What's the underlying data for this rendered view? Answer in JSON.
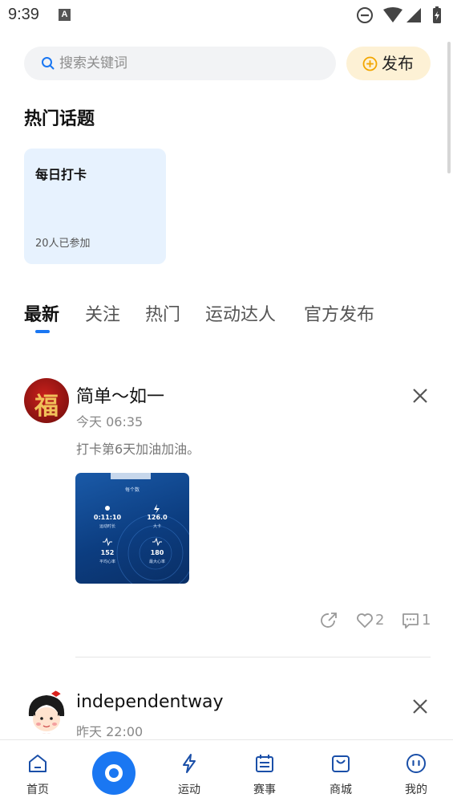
{
  "status_bar": {
    "time": "9:39",
    "notification_letter": "A"
  },
  "search": {
    "placeholder": "搜索关键词"
  },
  "publish_button": {
    "label": "发布"
  },
  "hot_topics": {
    "title": "热门话题",
    "items": [
      {
        "title": "每日打卡",
        "participants": "20人已参加"
      }
    ]
  },
  "tabs": [
    {
      "label": "最新",
      "active": true
    },
    {
      "label": "关注",
      "active": false
    },
    {
      "label": "热门",
      "active": false
    },
    {
      "label": "运动达人",
      "active": false
    },
    {
      "label": "官方发布",
      "active": false
    }
  ],
  "posts": [
    {
      "username": "简单～如一",
      "time": "今天 06:35",
      "content": "打卡第6天加油加油。",
      "avatar_char": "福",
      "image": {
        "unit": "每个数",
        "stats": [
          {
            "value": "0:11:10",
            "label": "运动时长"
          },
          {
            "value": "126.0",
            "label": "大卡"
          },
          {
            "value": "152",
            "label": "平均心率"
          },
          {
            "value": "180",
            "label": "最大心率"
          }
        ]
      },
      "likes": "2",
      "comments": "1"
    },
    {
      "username": "independentway",
      "time": "昨天 22:00"
    }
  ],
  "bottom_nav": [
    {
      "label": "首页",
      "icon": "home-icon"
    },
    {
      "label": "",
      "icon": "start-workout-icon"
    },
    {
      "label": "运动",
      "icon": "lightning-icon"
    },
    {
      "label": "赛事",
      "icon": "calendar-icon"
    },
    {
      "label": "商城",
      "icon": "shopping-bag-icon"
    },
    {
      "label": "我的",
      "icon": "profile-face-icon"
    }
  ],
  "colors": {
    "accent": "#1a77f2",
    "publish_bg": "#fdf1d5",
    "topic_card_bg": "#e7f2fe",
    "search_bg": "#f2f3f5"
  }
}
